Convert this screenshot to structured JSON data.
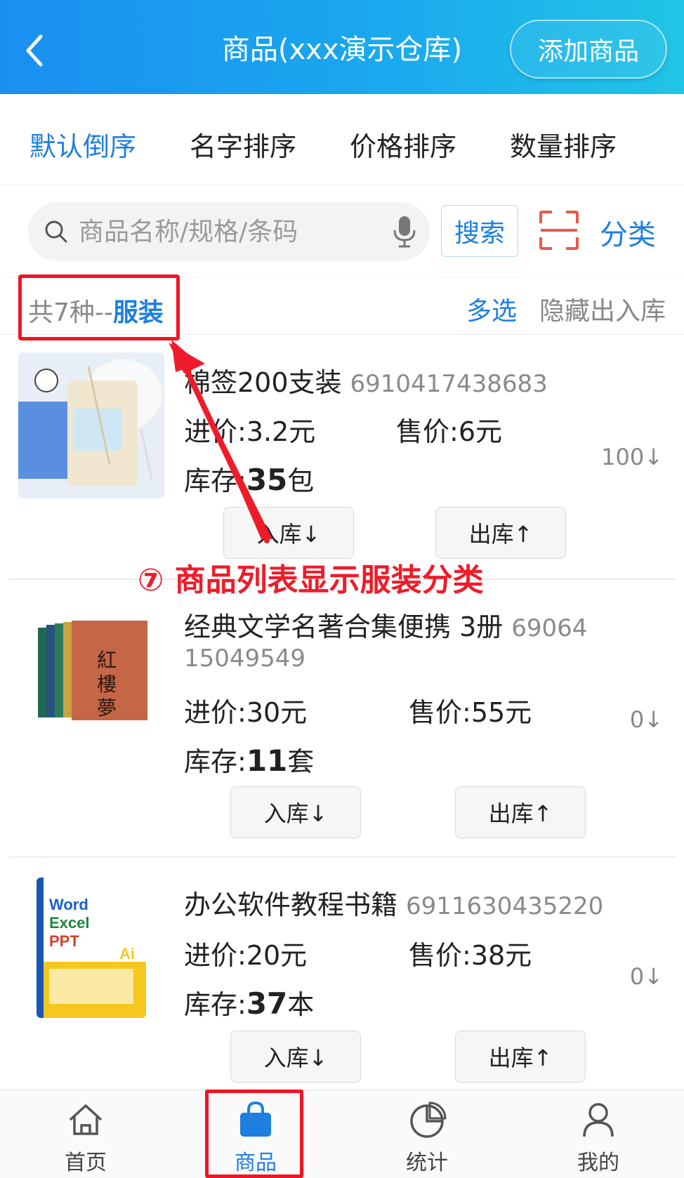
{
  "header": {
    "title": "商品(xxx演示仓库)",
    "add_button": "添加商品"
  },
  "sort_tabs": [
    {
      "label": "默认倒序",
      "active": true
    },
    {
      "label": "名字排序",
      "active": false
    },
    {
      "label": "价格排序",
      "active": false
    },
    {
      "label": "数量排序",
      "active": false
    }
  ],
  "search": {
    "placeholder": "商品名称/规格/条码",
    "button": "搜索",
    "category": "分类"
  },
  "summary": {
    "count_prefix": "共7种--",
    "category": "服装",
    "multi_select": "多选",
    "hide_io": "隐藏出入库"
  },
  "products": [
    {
      "name": "棉签200支装",
      "code": "6910417438683",
      "cost_label": "进价:",
      "cost": "3.2元",
      "price_label": "售价:",
      "price": "6元",
      "stock_label": "库存:",
      "stock_qty": "35",
      "stock_unit": "包",
      "qty_right": "100↓",
      "in_button": "入库↓",
      "out_button": "出库↑"
    },
    {
      "name": "经典文学名著合集便携  3册",
      "code_part1": "69064",
      "code_part2": "15049549",
      "cost_label": "进价:",
      "cost": "30元",
      "price_label": "售价:",
      "price": "55元",
      "stock_label": "库存:",
      "stock_qty": "11",
      "stock_unit": "套",
      "qty_right": "0↓",
      "in_button": "入库↓",
      "out_button": "出库↑"
    },
    {
      "name": "办公软件教程书籍",
      "code": "6911630435220",
      "cost_label": "进价:",
      "cost": "20元",
      "price_label": "售价:",
      "price": "38元",
      "stock_label": "库存:",
      "stock_qty": "37",
      "stock_unit": "本",
      "qty_right": "0↓",
      "in_button": "入库↓",
      "out_button": "出库↑"
    }
  ],
  "annotation": "⑦ 商品列表显示服装分类",
  "bottom_nav": [
    {
      "label": "首页",
      "icon": "home-icon",
      "active": false
    },
    {
      "label": "商品",
      "icon": "shopping-bag-icon",
      "active": true
    },
    {
      "label": "统计",
      "icon": "pie-chart-icon",
      "active": false
    },
    {
      "label": "我的",
      "icon": "user-icon",
      "active": false
    }
  ],
  "colors": {
    "accent": "#1e7fe0",
    "highlight": "#f21424"
  }
}
